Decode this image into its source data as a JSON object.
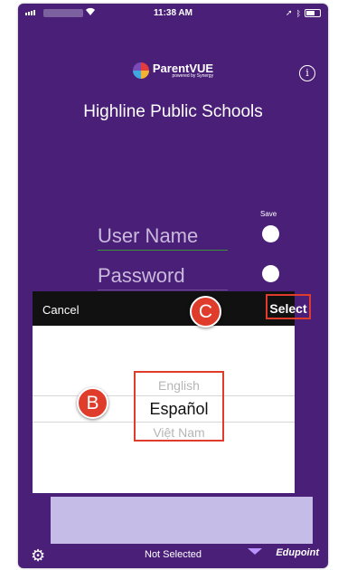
{
  "status_bar": {
    "time": "11:38 AM",
    "signal_icon": "signal-icon",
    "wifi_icon": "wifi-icon",
    "location_icon": "location-arrow-icon",
    "bluetooth_icon": "bluetooth-icon",
    "battery_icon": "battery-icon"
  },
  "header": {
    "logo_name": "ParentVUE",
    "logo_sub": "powered by Synergy",
    "info_icon": "info-icon",
    "district": "Highline Public Schools"
  },
  "login": {
    "save_label": "Save",
    "username_placeholder": "User Name",
    "password_placeholder": "Password"
  },
  "picker": {
    "cancel_label": "Cancel",
    "select_label": "Select",
    "options": [
      "English",
      "Español",
      "Việt Nam"
    ],
    "selected": "Español"
  },
  "callouts": {
    "b": "B",
    "c": "C"
  },
  "footer": {
    "gear_icon": "gear-icon",
    "status": "Not Selected",
    "brand": "Edupoint"
  },
  "colors": {
    "background": "#4a1f78",
    "callout": "#e03c2c",
    "picker_footer": "#c6bce8"
  }
}
